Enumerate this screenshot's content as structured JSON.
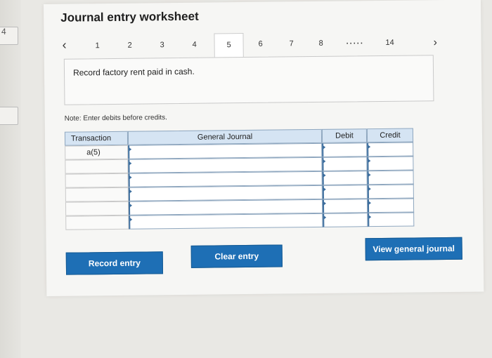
{
  "edge": {
    "number": "4"
  },
  "worksheet": {
    "title": "Journal entry worksheet",
    "nav": {
      "prev_icon": "chevron-left-icon",
      "next_icon": "chevron-right-icon",
      "items": [
        "1",
        "2",
        "3",
        "4",
        "5",
        "6",
        "7",
        "8",
        "14"
      ],
      "active": "5",
      "dots": "....."
    },
    "prompt": "Record factory rent paid in cash.",
    "note": "Note: Enter debits before credits.",
    "journal": {
      "headers": {
        "transaction": "Transaction",
        "general_journal": "General Journal",
        "debit": "Debit",
        "credit": "Credit"
      },
      "rows": [
        {
          "transaction": "a(5)",
          "account": "",
          "debit": "",
          "credit": ""
        },
        {
          "transaction": "",
          "account": "",
          "debit": "",
          "credit": ""
        },
        {
          "transaction": "",
          "account": "",
          "debit": "",
          "credit": ""
        },
        {
          "transaction": "",
          "account": "",
          "debit": "",
          "credit": ""
        },
        {
          "transaction": "",
          "account": "",
          "debit": "",
          "credit": ""
        },
        {
          "transaction": "",
          "account": "",
          "debit": "",
          "credit": ""
        }
      ]
    },
    "buttons": {
      "record": "Record entry",
      "clear": "Clear entry",
      "view": "View general journal"
    }
  },
  "colors": {
    "accent": "#1e6fb5",
    "header_bg": "#d5e4f3"
  }
}
